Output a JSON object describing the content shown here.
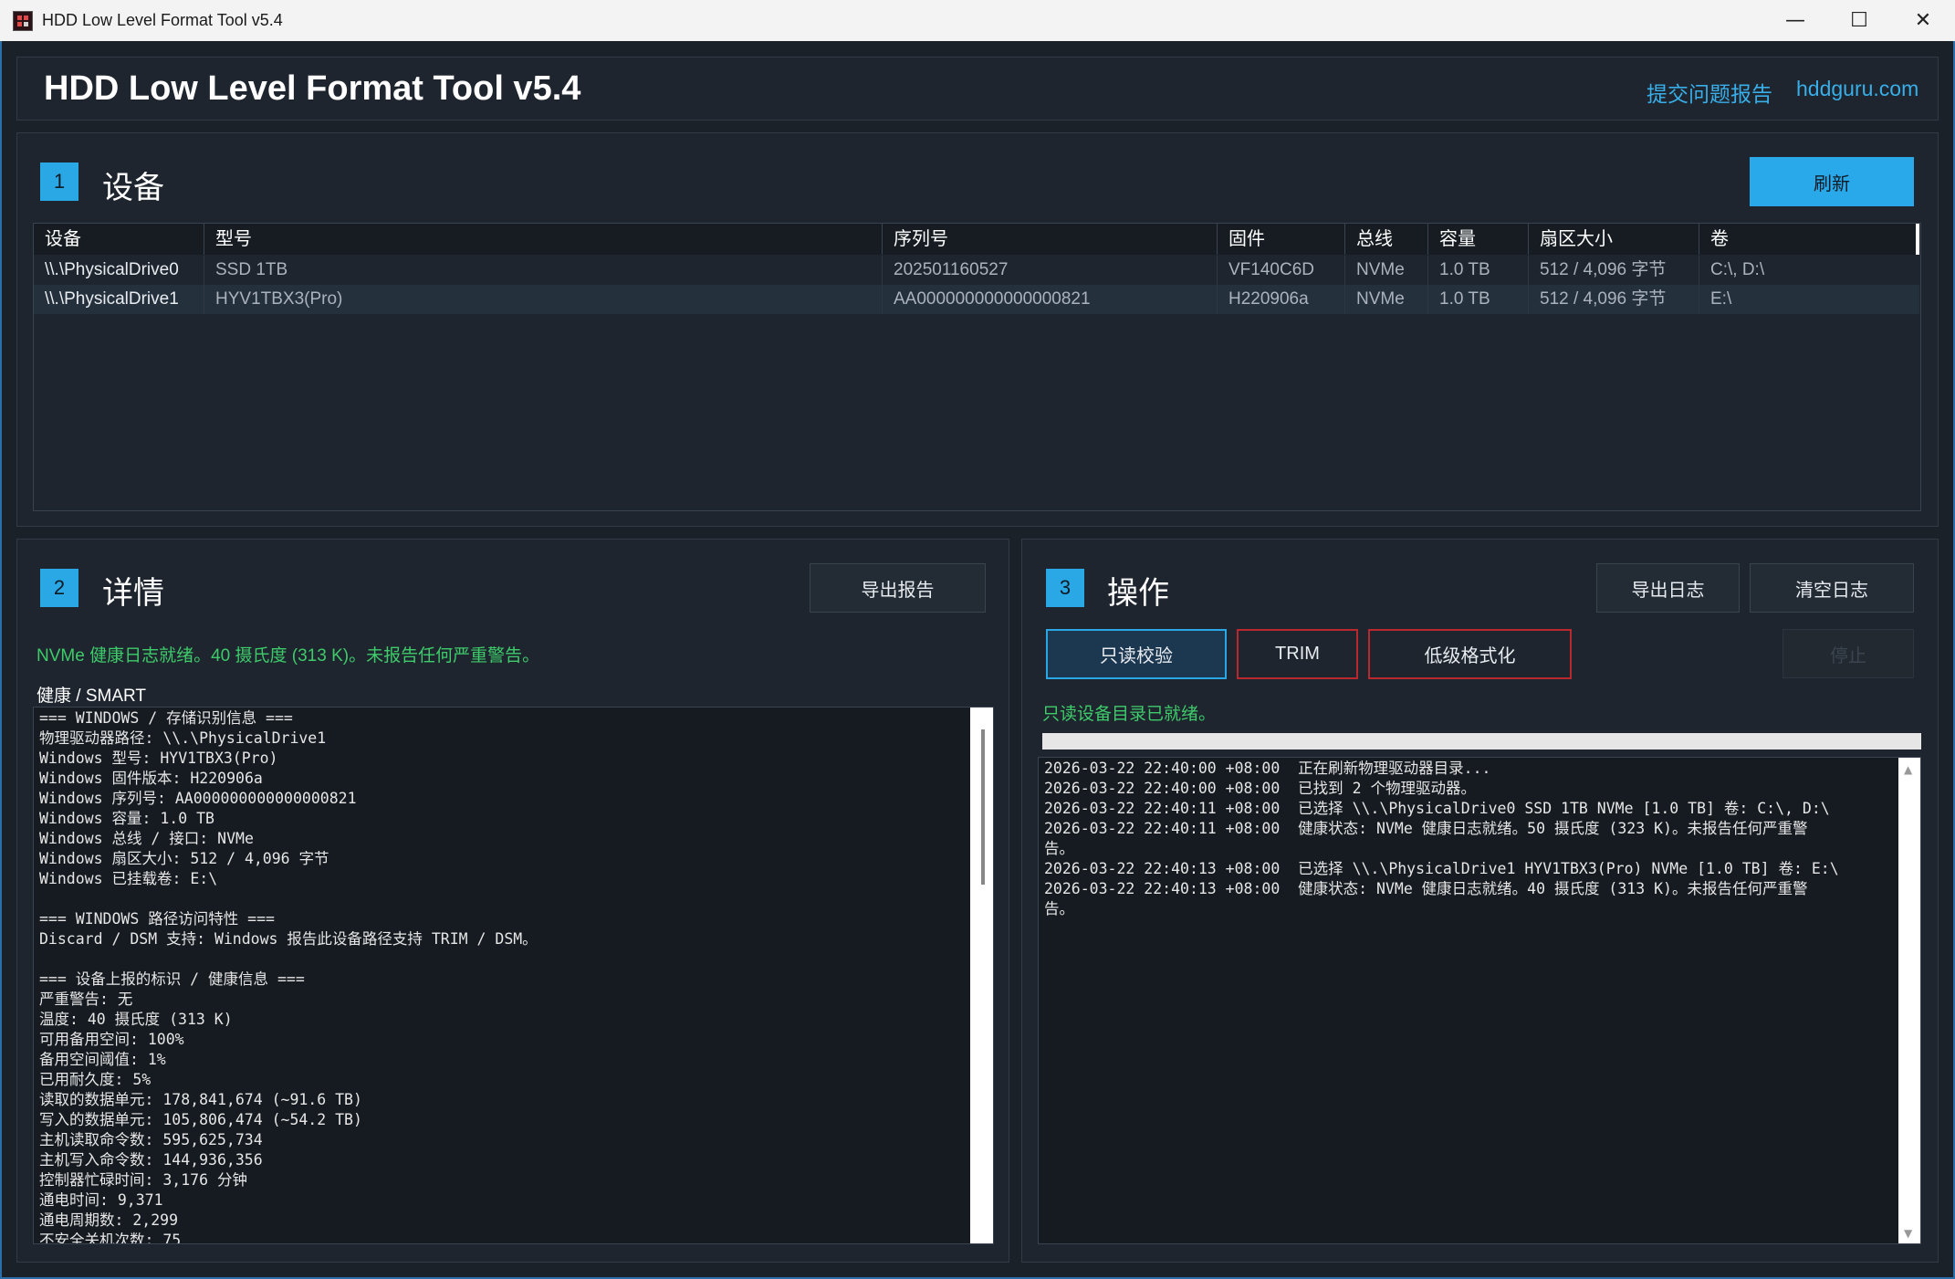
{
  "window": {
    "title": "HDD Low Level Format Tool v5.4",
    "minimize": "—",
    "maximize": "☐",
    "close": "✕"
  },
  "header": {
    "title": "HDD Low Level Format Tool v5.4",
    "report_link": "提交问题报告",
    "site_link": "hddguru.com"
  },
  "devices": {
    "number": "1",
    "title": "设备",
    "refresh_label": "刷新",
    "columns": [
      "设备",
      "型号",
      "序列号",
      "固件",
      "总线",
      "容量",
      "扇区大小",
      "卷"
    ],
    "rows": [
      [
        "\\\\.\\PhysicalDrive0",
        "SSD 1TB",
        "202501160527",
        "VF140C6D",
        "NVMe",
        "1.0 TB",
        "512 / 4,096 字节",
        "C:\\, D:\\"
      ],
      [
        "\\\\.\\PhysicalDrive1",
        "HYV1TBX3(Pro)",
        "AA000000000000000821",
        "H220906a",
        "NVMe",
        "1.0 TB",
        "512 / 4,096 字节",
        "E:\\"
      ]
    ],
    "selected_row": 1
  },
  "details": {
    "number": "2",
    "title": "详情",
    "export_label": "导出报告",
    "status": "NVMe 健康日志就绪。40 摄氏度 (313 K)。未报告任何严重警告。",
    "smart_label": "健康 / SMART",
    "smart_text": "=== WINDOWS / 存储识别信息 ===\n物理驱动器路径: \\\\.\\PhysicalDrive1\nWindows 型号: HYV1TBX3(Pro)\nWindows 固件版本: H220906a\nWindows 序列号: AA000000000000000821\nWindows 容量: 1.0 TB\nWindows 总线 / 接口: NVMe\nWindows 扇区大小: 512 / 4,096 字节\nWindows 已挂载卷: E:\\\n\n=== WINDOWS 路径访问特性 ===\nDiscard / DSM 支持: Windows 报告此设备路径支持 TRIM / DSM。\n\n=== 设备上报的标识 / 健康信息 ===\n严重警告: 无\n温度: 40 摄氏度 (313 K)\n可用备用空间: 100%\n备用空间阈值: 1%\n已用耐久度: 5%\n读取的数据单元: 178,841,674 (~91.6 TB)\n写入的数据单元: 105,806,474 (~54.2 TB)\n主机读取命令数: 595,625,734\n主机写入命令数: 144,936,356\n控制器忙碌时间: 3,176 分钟\n通电时间: 9,371\n通电周期数: 2,299\n不安全关机次数: 75"
  },
  "operations": {
    "number": "3",
    "title": "操作",
    "export_log_label": "导出日志",
    "clear_log_label": "清空日志",
    "readonly_label": "只读校验",
    "trim_label": "TRIM",
    "lowformat_label": "低级格式化",
    "stop_label": "停止",
    "status": "只读设备目录已就绪。",
    "progress": 0,
    "log_text": "2026-03-22 22:40:00 +08:00  正在刷新物理驱动器目录...\n2026-03-22 22:40:00 +08:00  已找到 2 个物理驱动器。\n2026-03-22 22:40:11 +08:00  已选择 \\\\.\\PhysicalDrive0 SSD 1TB NVMe [1.0 TB] 卷: C:\\, D:\\\n2026-03-22 22:40:11 +08:00  健康状态: NVMe 健康日志就绪。50 摄氏度 (323 K)。未报告任何严重警\n告。\n2026-03-22 22:40:13 +08:00  已选择 \\\\.\\PhysicalDrive1 HYV1TBX3(Pro) NVMe [1.0 TB] 卷: E:\\\n2026-03-22 22:40:13 +08:00  健康状态: NVMe 健康日志就绪。40 摄氏度 (313 K)。未报告任何严重警\n告。",
    "scroll_up": "▲",
    "scroll_down": "▼"
  }
}
